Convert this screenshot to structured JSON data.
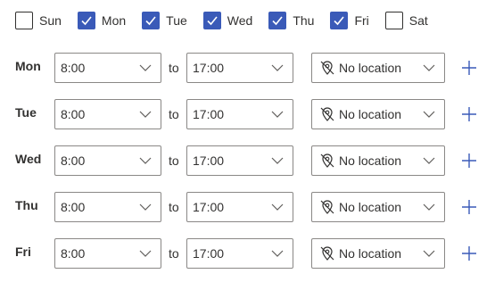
{
  "weekdays": [
    {
      "label": "Sun",
      "checked": false
    },
    {
      "label": "Mon",
      "checked": true
    },
    {
      "label": "Tue",
      "checked": true
    },
    {
      "label": "Wed",
      "checked": true
    },
    {
      "label": "Thu",
      "checked": true
    },
    {
      "label": "Fri",
      "checked": true
    },
    {
      "label": "Sat",
      "checked": false
    }
  ],
  "to_label": "to",
  "schedule": [
    {
      "day": "Mon",
      "start": "8:00",
      "end": "17:00",
      "location": "No location"
    },
    {
      "day": "Tue",
      "start": "8:00",
      "end": "17:00",
      "location": "No location"
    },
    {
      "day": "Wed",
      "start": "8:00",
      "end": "17:00",
      "location": "No location"
    },
    {
      "day": "Thu",
      "start": "8:00",
      "end": "17:00",
      "location": "No location"
    },
    {
      "day": "Fri",
      "start": "8:00",
      "end": "17:00",
      "location": "No location"
    }
  ],
  "icons": {
    "checkbox_check": "checkmark-icon",
    "dropdown": "chevron-down-icon",
    "location": "location-off-icon",
    "add": "plus-icon"
  },
  "colors": {
    "accent": "#3a5ab8",
    "border": "#8a8886",
    "text": "#323130"
  }
}
